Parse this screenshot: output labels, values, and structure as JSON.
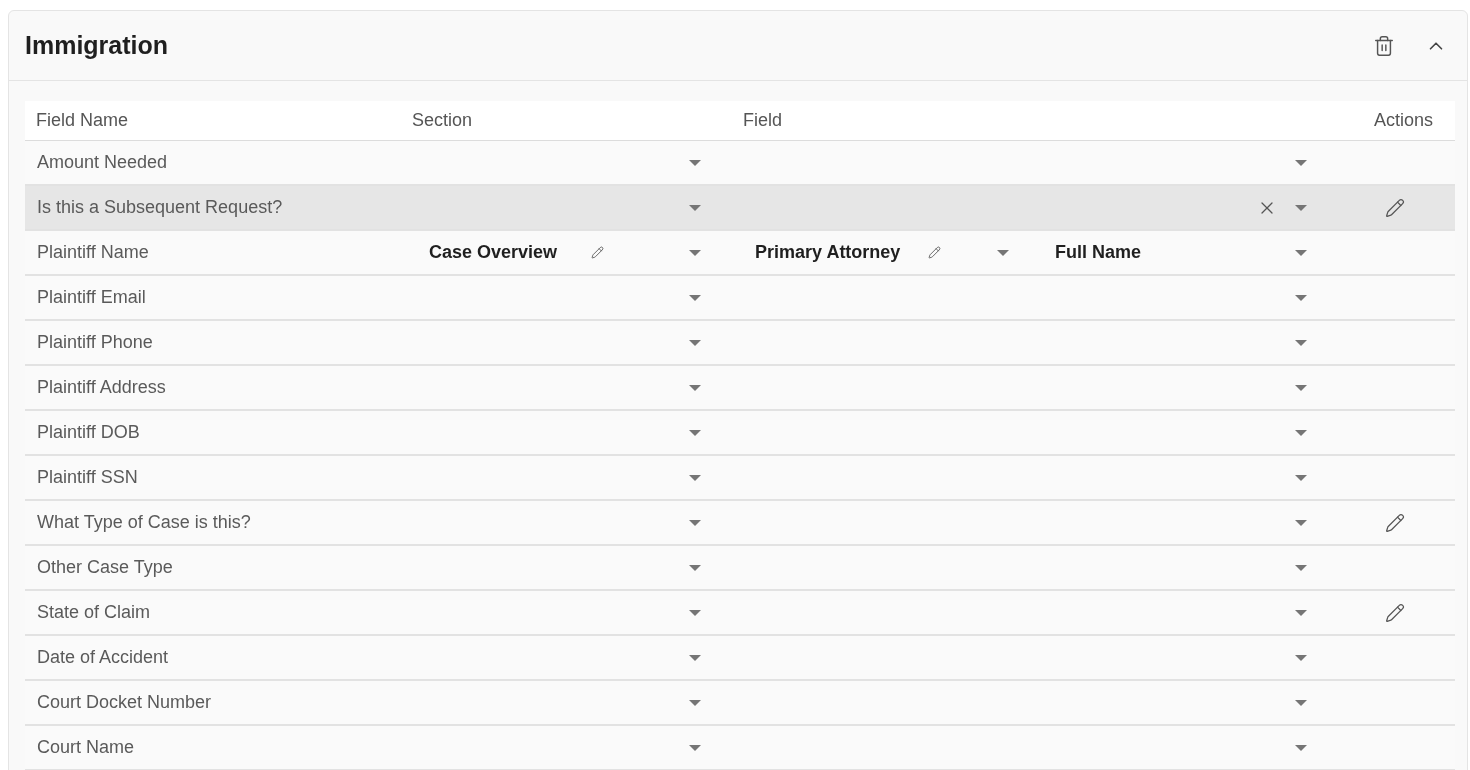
{
  "card": {
    "title": "Immigration",
    "expanded": true
  },
  "table": {
    "columns": [
      "Field Name",
      "Section",
      "Field",
      "Actions"
    ],
    "rows": [
      {
        "name": "Amount Needed",
        "highlighted": false,
        "clearable": false,
        "editable": false
      },
      {
        "name": "Is this a Subsequent Request?",
        "highlighted": true,
        "clearable": true,
        "editable": true
      },
      {
        "name": "Plaintiff Name",
        "section": "Case Overview",
        "field": "Primary Attorney",
        "subfield": "Full Name",
        "highlighted": false,
        "clearable": false,
        "editable": false
      },
      {
        "name": "Plaintiff Email",
        "highlighted": false,
        "clearable": false,
        "editable": false
      },
      {
        "name": "Plaintiff Phone",
        "highlighted": false,
        "clearable": false,
        "editable": false
      },
      {
        "name": "Plaintiff Address",
        "highlighted": false,
        "clearable": false,
        "editable": false
      },
      {
        "name": "Plaintiff DOB",
        "highlighted": false,
        "clearable": false,
        "editable": false
      },
      {
        "name": "Plaintiff SSN",
        "highlighted": false,
        "clearable": false,
        "editable": false
      },
      {
        "name": "What Type of Case is this?",
        "highlighted": false,
        "clearable": false,
        "editable": true
      },
      {
        "name": "Other Case Type",
        "highlighted": false,
        "clearable": false,
        "editable": false
      },
      {
        "name": "State of Claim",
        "highlighted": false,
        "clearable": false,
        "editable": true
      },
      {
        "name": "Date of Accident",
        "highlighted": false,
        "clearable": false,
        "editable": false
      },
      {
        "name": "Court Docket Number",
        "highlighted": false,
        "clearable": false,
        "editable": false
      },
      {
        "name": "Court Name",
        "highlighted": false,
        "clearable": false,
        "editable": false
      }
    ]
  }
}
